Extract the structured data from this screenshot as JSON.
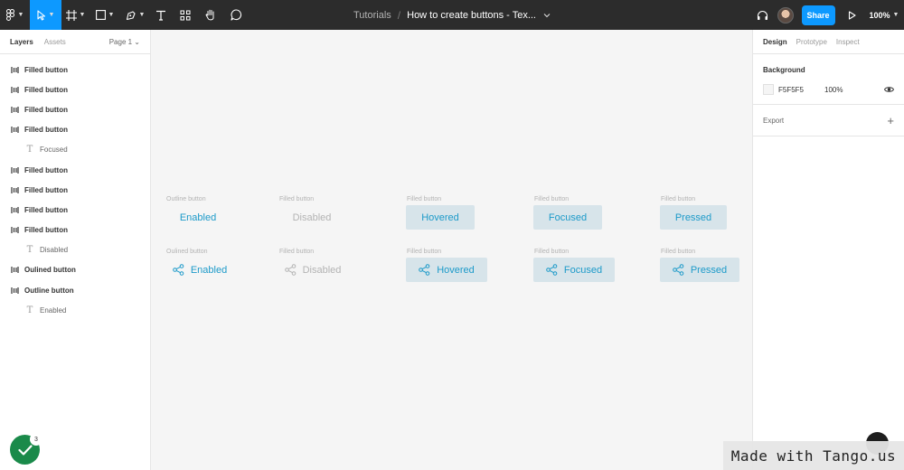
{
  "toolbar": {
    "breadcrumb": {
      "project": "Tutorials",
      "separator": "/",
      "file": "How to create buttons - Tex..."
    },
    "share_label": "Share",
    "zoom": "100%",
    "colors": {
      "bar": "#2c2c2c",
      "accent": "#0d99ff"
    }
  },
  "left_panel": {
    "tabs": [
      "Layers",
      "Assets"
    ],
    "page": "Page 1 ⌄",
    "layers": [
      {
        "label": "Filled button",
        "type": "frame"
      },
      {
        "label": "Filled button",
        "type": "frame"
      },
      {
        "label": "Filled button",
        "type": "frame"
      },
      {
        "label": "Filled button",
        "type": "frame"
      },
      {
        "label": "Focused",
        "type": "text"
      },
      {
        "label": "Filled button",
        "type": "frame"
      },
      {
        "label": "Filled button",
        "type": "frame"
      },
      {
        "label": "Filled button",
        "type": "frame"
      },
      {
        "label": "Filled button",
        "type": "frame"
      },
      {
        "label": "Disabled",
        "type": "text"
      },
      {
        "label": "Oulined button",
        "type": "frame"
      },
      {
        "label": "Outline button",
        "type": "frame"
      },
      {
        "label": "Enabled",
        "type": "text"
      }
    ]
  },
  "right_panel": {
    "tabs": [
      "Design",
      "Prototype",
      "Inspect"
    ],
    "background": {
      "heading": "Background",
      "hex": "F5F5F5",
      "opacity": "100%"
    },
    "export": {
      "label": "Export"
    }
  },
  "canvas": {
    "row1": [
      {
        "caption": "Outline button",
        "label": "Enabled",
        "style": "enabled"
      },
      {
        "caption": "Filled button",
        "label": "Disabled",
        "style": "disabled"
      },
      {
        "caption": "Filled button",
        "label": "Hovered",
        "style": "filled"
      },
      {
        "caption": "Filled button",
        "label": "Focused",
        "style": "filled"
      },
      {
        "caption": "Filled button",
        "label": "Pressed",
        "style": "filled"
      }
    ],
    "row2": [
      {
        "caption": "Oulined button",
        "label": "Enabled",
        "style": "enabled"
      },
      {
        "caption": "Filled button",
        "label": "Disabled",
        "style": "disabled"
      },
      {
        "caption": "Filled button",
        "label": "Hovered",
        "style": "filled"
      },
      {
        "caption": "Filled button",
        "label": "Focused",
        "style": "filled"
      },
      {
        "caption": "Filled button",
        "label": "Pressed",
        "style": "filled"
      }
    ],
    "colors": {
      "accent_text": "#1c9ac9",
      "filled_bg": "#d7e4ea",
      "disabled_text": "#b3b3b3"
    }
  },
  "overlay": {
    "tango_count": "3",
    "watermark": "Made with Tango.us"
  }
}
